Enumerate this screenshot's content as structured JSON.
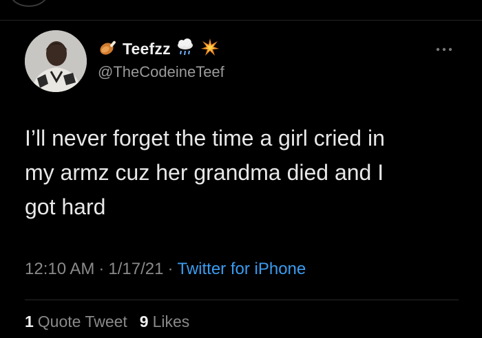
{
  "tweet": {
    "display_name": "Teefzz",
    "handle": "@TheCodeineTeef",
    "text": "I’ll never forget the time a girl cried in\nmy armz cuz her grandma died and I\ngot hard",
    "time": "12:10 AM",
    "date": "1/17/21",
    "source": "Twitter for iPhone",
    "separator": "·",
    "name_emoji_icons": [
      "drumstick-icon",
      "rain-cloud-icon",
      "explosion-icon"
    ],
    "more_icon": "more-icon"
  },
  "stats": {
    "quote_count": "1",
    "quote_label": "Quote Tweet",
    "like_count": "9",
    "like_label": "Likes"
  },
  "colors": {
    "background": "#000000",
    "link": "#3b9cf0",
    "secondary_text": "#8a8a8a"
  }
}
